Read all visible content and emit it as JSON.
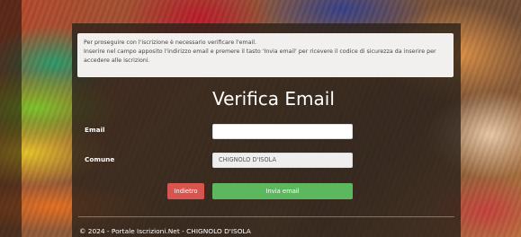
{
  "notice": {
    "line1": "Per proseguire con l'iscrizione è necessario verificare l'email.",
    "line2": "Inserire nel campo apposito l'indirizzo email e premere il tasto 'Invia email' per ricevere il codice di sicurezza da inserire per",
    "line3": "accedere alle iscrizioni."
  },
  "form": {
    "title": "Verifica Email",
    "email_label": "Email",
    "email_value": "",
    "comune_label": "Comune",
    "comune_value": "CHIGNOLO D'ISOLA"
  },
  "buttons": {
    "back_label": "Indietro",
    "send_label": "Invia email",
    "back_color": "#d9534f",
    "send_color": "#5cb85c"
  },
  "footer": {
    "text": "© 2024 - Portale Iscrizioni.Net - CHIGNOLO D'ISOLA"
  }
}
